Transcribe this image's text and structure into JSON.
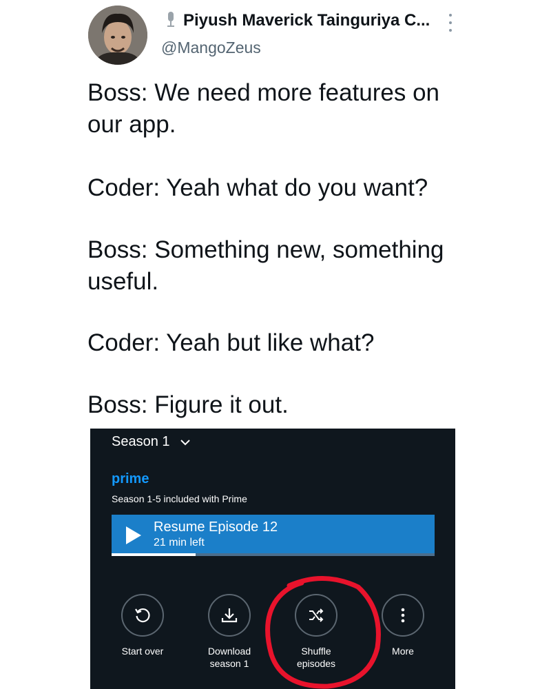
{
  "tweet": {
    "display_name": "Piyush Maverick Tainguriya C...",
    "handle": "@MangoZeus",
    "paragraphs": [
      "Boss: We need more features on our app.",
      "Coder: Yeah what do you want?",
      "Boss: Something new, something useful.",
      "Coder: Yeah but like what?",
      "Boss: Figure it out."
    ]
  },
  "prime_screen": {
    "season_selector": "Season 1",
    "brand": "prime",
    "included_text": "Season 1-5 included with Prime",
    "resume": {
      "title": "Resume Episode 12",
      "subtitle": "21 min left",
      "progress_fraction": 0.26
    },
    "actions": [
      {
        "label_line1": "Start over",
        "label_line2": ""
      },
      {
        "label_line1": "Download",
        "label_line2": "season 1"
      },
      {
        "label_line1": "Shuffle",
        "label_line2": "episodes"
      },
      {
        "label_line1": "More",
        "label_line2": ""
      }
    ]
  },
  "colors": {
    "prime_bg": "#0f171e",
    "prime_blue": "#1399ff",
    "resume_button": "#1b7fc9",
    "annotation_red": "#e8132c",
    "handle_gray": "#536471"
  },
  "icons": [
    "microphone-icon",
    "more-vertical-icon",
    "chevron-down-icon",
    "play-icon",
    "restart-icon",
    "download-icon",
    "shuffle-icon",
    "more-horizontal-dots-icon"
  ]
}
